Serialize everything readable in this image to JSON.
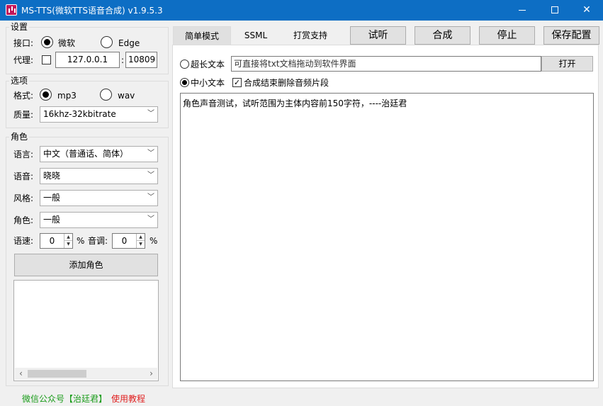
{
  "window": {
    "title": "MS-TTS(微软TTS语音合成) v1.9.5.3",
    "minimize_glyph": "—",
    "maximize_glyph": "☐",
    "close_glyph": "✕"
  },
  "settings": {
    "group_title": "设置",
    "interface_label": "接口:",
    "interface_options": [
      "微软",
      "Edge"
    ],
    "interface_selected": "微软",
    "proxy_label": "代理:",
    "proxy_enabled": false,
    "proxy_host": "127.0.0.1",
    "proxy_separator": ":",
    "proxy_port": "10809"
  },
  "options": {
    "group_title": "选项",
    "format_label": "格式:",
    "format_options": [
      "mp3",
      "wav"
    ],
    "format_selected": "mp3",
    "quality_label": "质量:",
    "quality_value": "16khz-32kbitrate"
  },
  "role": {
    "group_title": "角色",
    "language_label": "语言:",
    "language_value": "中文（普通话、简体）",
    "voice_label": "语音:",
    "voice_value": "晓晓",
    "style_label": "风格:",
    "style_value": "一般",
    "role_label": "角色:",
    "role_value": "一般",
    "rate_label": "语速:",
    "rate_value": "0",
    "rate_unit": "%",
    "pitch_label": "音调:",
    "pitch_value": "0",
    "pitch_unit": "%",
    "add_role_label": "添加角色"
  },
  "toolbar": {
    "tabs": [
      "简单模式",
      "SSML",
      "打赏支持"
    ],
    "active_tab": "简单模式",
    "listen_label": "试听",
    "synthesize_label": "合成",
    "stop_label": "停止",
    "save_config_label": "保存配置"
  },
  "simple_mode": {
    "long_text_label": "超长文本",
    "long_text_path_placeholder": "可直接将txt文档拖动到软件界面",
    "open_label": "打开",
    "short_text_label": "中小文本",
    "text_mode_selected": "中小文本",
    "delete_fragments_label": "合成结束删除音频片段",
    "delete_fragments_checked": true,
    "check_mark": "✓",
    "editor_text": "角色声音测试，试听范围为主体内容前150字符，----治廷君"
  },
  "footer": {
    "wechat_text": "微信公众号【治廷君】",
    "tutorial_text": "使用教程"
  },
  "colors": {
    "titlebar": "#0d6ec4",
    "footer_green": "#1a9c1a",
    "footer_red": "#e02020"
  }
}
